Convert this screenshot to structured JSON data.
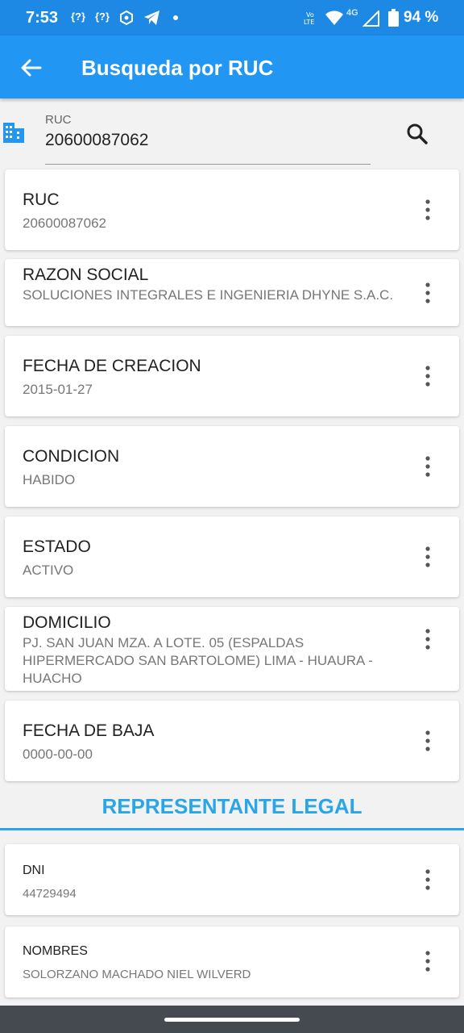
{
  "status_bar": {
    "time": "7:53",
    "notif_1": "{?}",
    "notif_2": "{?}",
    "battery": "94 %",
    "net": "4G"
  },
  "app_bar": {
    "title": "Busqueda por RUC",
    "back_icon": "arrow-back-icon"
  },
  "search": {
    "label": "RUC",
    "value": "20600087062",
    "icon": "building-icon",
    "button_icon": "search-icon"
  },
  "cards": [
    {
      "label": "RUC",
      "value": "20600087062"
    },
    {
      "label": "RAZON SOCIAL",
      "value": "SOLUCIONES INTEGRALES E INGENIERIA DHYNE S.A.C."
    },
    {
      "label": "FECHA DE CREACION",
      "value": "2015-01-27"
    },
    {
      "label": "CONDICION",
      "value": "HABIDO"
    },
    {
      "label": "ESTADO",
      "value": "ACTIVO"
    },
    {
      "label": "DOMICILIO",
      "value": "PJ. SAN JUAN MZA. A LOTE. 05 (ESPALDAS HIPERMERCADO SAN BARTOLOME) LIMA - HUAURA - HUACHO"
    },
    {
      "label": "FECHA DE BAJA",
      "value": "0000-00-00"
    }
  ],
  "section": {
    "title": "REPRESENTANTE LEGAL"
  },
  "legal_cards": [
    {
      "label": "DNI",
      "value": "44729494"
    },
    {
      "label": "NOMBRES",
      "value": "SOLORZANO MACHADO NIEL WILVERD"
    }
  ],
  "colors": {
    "app_bar": "#2196f3",
    "status_bar": "#1e88e5",
    "section_accent": "#2aa6e8"
  }
}
